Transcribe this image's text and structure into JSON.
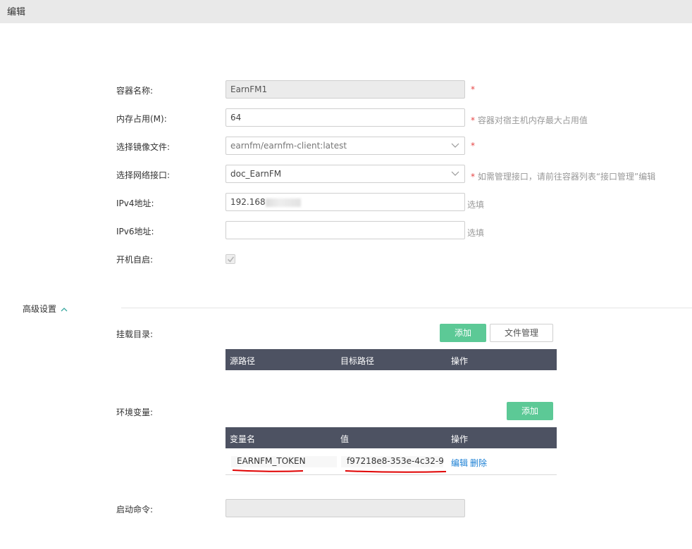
{
  "header": {
    "title": "编辑"
  },
  "form": {
    "name": {
      "label": "容器名称:",
      "value": "EarnFM1",
      "required": "*"
    },
    "memory": {
      "label": "内存占用(M):",
      "value": "64",
      "hint_star": "*",
      "hint": "容器对宿主机内存最大占用值"
    },
    "image": {
      "label": "选择镜像文件:",
      "value": "earnfm/earnfm-client:latest",
      "required": "*"
    },
    "network": {
      "label": "选择网络接口:",
      "value": "doc_EarnFM",
      "hint_star": "*",
      "hint": "如需管理接口，请前往容器列表“接口管理”编辑"
    },
    "ipv4": {
      "label": "IPv4地址:",
      "value": "192.168",
      "hint": "选填"
    },
    "ipv6": {
      "label": "IPv6地址:",
      "value": "",
      "hint": "选填"
    },
    "autostart": {
      "label": "开机自启:",
      "checked": true
    }
  },
  "advanced": {
    "toggle_label": "高级设置",
    "mount": {
      "label": "挂载目录:",
      "add_label": "添加",
      "file_manage_label": "文件管理",
      "columns": [
        "源路径",
        "目标路径",
        "操作"
      ]
    },
    "env": {
      "label": "环境变量:",
      "add_label": "添加",
      "columns": [
        "变量名",
        "值",
        "操作"
      ],
      "rows": [
        {
          "name": "EARNFM_TOKEN",
          "value": "f97218e8-353e-4c32-9",
          "edit": "编辑",
          "delete": "删除"
        }
      ]
    },
    "command": {
      "label": "启动命令:",
      "value": ""
    }
  },
  "colors": {
    "accent_green": "#5cc996",
    "table_header": "#4d5262",
    "required_red": "#e64545",
    "link_blue": "#1a7fd4",
    "annotation_red": "#e00000"
  },
  "icons": {
    "select_chevron": "chevron-down-icon",
    "checkbox_check": "check-icon",
    "collapse": "chevron-up-icon"
  }
}
